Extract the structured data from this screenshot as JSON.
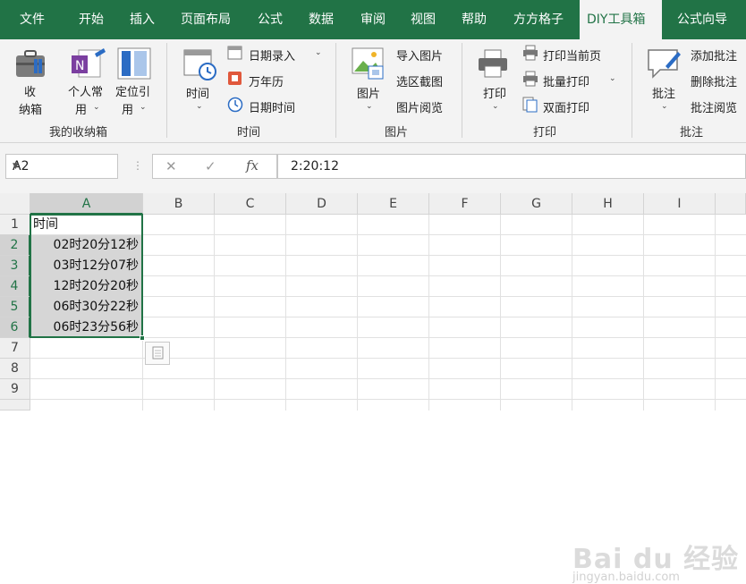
{
  "tabs": [
    "文件",
    "开始",
    "插入",
    "页面布局",
    "公式",
    "数据",
    "审阅",
    "视图",
    "帮助",
    "方方格子",
    "DIY工具箱",
    "公式向导"
  ],
  "active_tab": "DIY工具箱",
  "ribbon": {
    "group1": {
      "label": "我的收纳箱",
      "btn1_line1": "收",
      "btn1_line2": "纳箱",
      "btn2_line1": "个人常",
      "btn2_line2": "用",
      "btn3_line1": "定位引",
      "btn3_line2": "用"
    },
    "group2": {
      "label": "时间",
      "big": "时间",
      "item1": "日期录入",
      "item2": "万年历",
      "item3": "日期时间"
    },
    "group3": {
      "label": "图片",
      "big": "图片",
      "item1": "导入图片",
      "item2": "选区截图",
      "item3": "图片阅览"
    },
    "group4": {
      "label": "打印",
      "big": "打印",
      "item1": "打印当前页",
      "item2": "批量打印",
      "item3": "双面打印"
    },
    "group5": {
      "label": "批注",
      "big": "批注",
      "item1": "添加批注",
      "item2": "删除批注",
      "item3": "批注阅览"
    }
  },
  "formula_bar": {
    "name_box": "A2",
    "cancel": "✕",
    "enter": "✓",
    "fx": "fx",
    "value": "2:20:12"
  },
  "columns": [
    "A",
    "B",
    "C",
    "D",
    "E",
    "F",
    "G",
    "H",
    "I"
  ],
  "rows": [
    "1",
    "2",
    "3",
    "4",
    "5",
    "6",
    "7",
    "8",
    "9"
  ],
  "cells": {
    "A1": "时间",
    "A2": "02时20分12秒",
    "A3": "03时12分07秒",
    "A4": "12时20分20秒",
    "A5": "06时30分22秒",
    "A6": "06时23分56秒"
  },
  "watermark": {
    "main": "Bai du 经验",
    "sub": "jingyan.baidu.com"
  },
  "colors": {
    "accent": "#217346",
    "ribbon_bg": "#f3f3f3",
    "selection": "#d6d6d6"
  }
}
